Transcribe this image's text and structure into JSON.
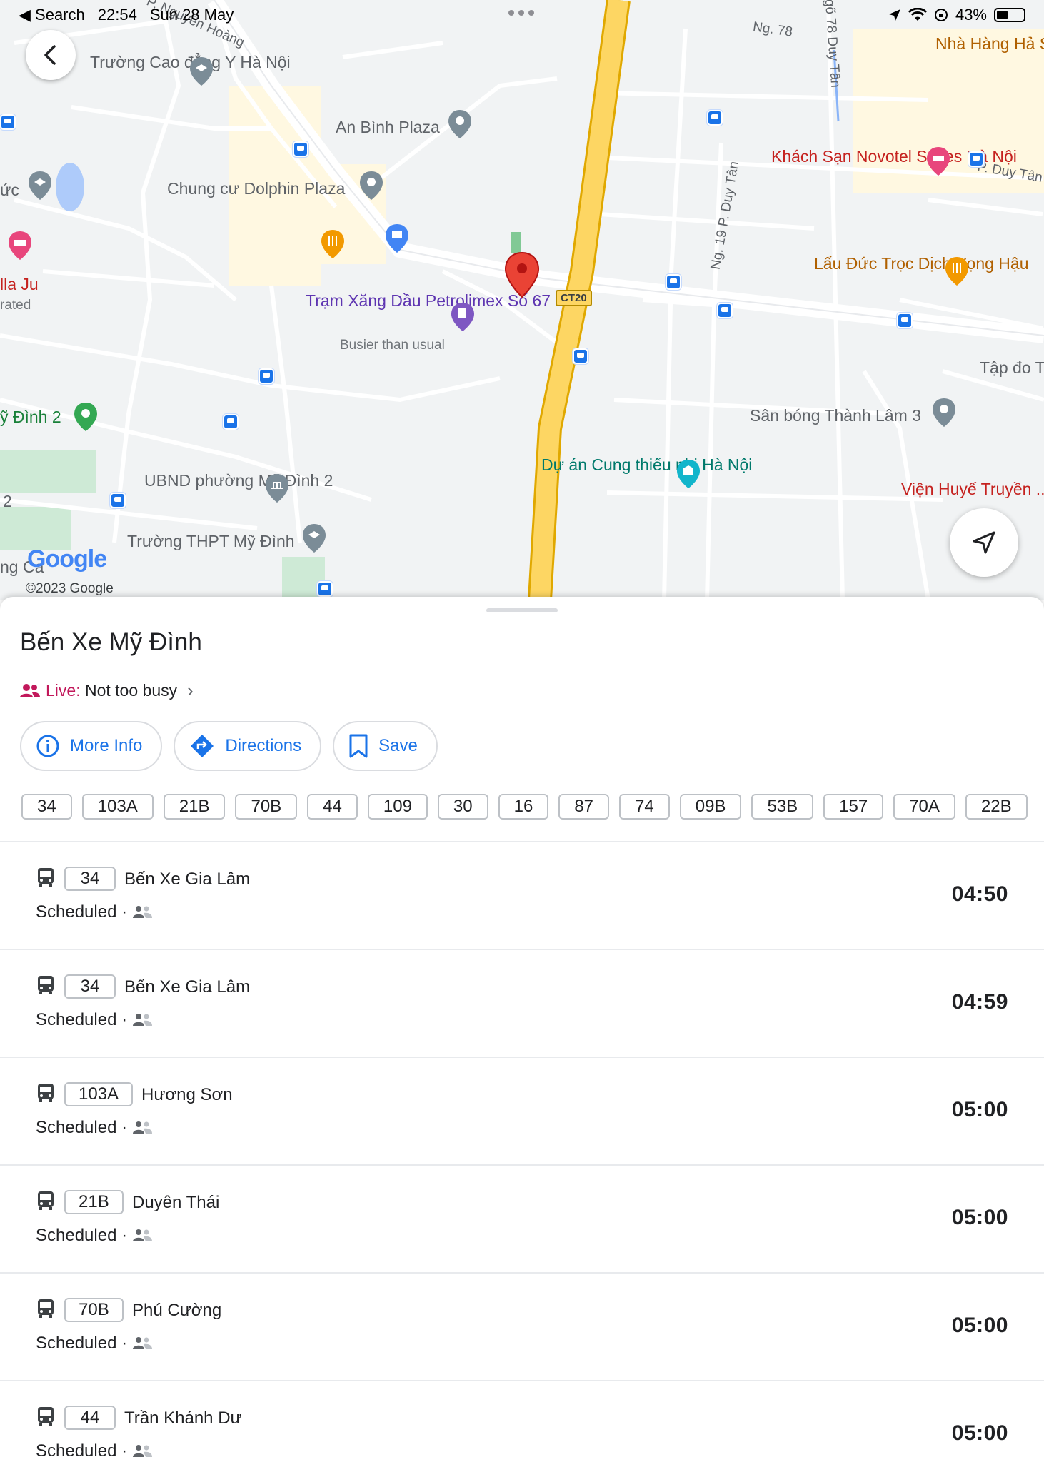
{
  "status_bar": {
    "back_app": "◀ Search",
    "time": "22:54",
    "date": "Sun 28 May",
    "battery": "43%",
    "battery_level": 0.43
  },
  "map": {
    "labels": {
      "truong_cao_dang": "Trường Cao đẳng Y Hà Nội",
      "an_binh_plaza": "An Bình Plaza",
      "chung_cu_dolphin": "Chung cư Dolphin Plaza",
      "tram_xang": "Trạm Xăng Dầu Petrolimex Số 67",
      "busier": "Busier than usual",
      "my_dinh_2": "ỹ Đình 2",
      "ubnd": "UBND phường Mỹ Đình 2",
      "thpt": "Trường THPT Mỹ Đình",
      "khach_san": "Khách Sạn Novotel Suites Hà Nội",
      "lau_duc": "Lẩu Đức Trọc Dịch Vọng Hậu",
      "san_bong": "Sân bóng Thành Lâm 3",
      "du_an": "Dự án Cung thiếu nhi Hà Nội",
      "nha_hang": "Nhà Hàng Hả Sản Biển Đôn",
      "vien_huye": "Viện Huyế Truyền ... Trun",
      "tap_do": "Tập đo Trụ",
      "road_ng78": "Ng. 78",
      "road_duy_tan": "P. Duy Tân",
      "road_ng19": "Ng. 19 P. Duy Tân",
      "road_ngo78": "Ngõ 78 Duy Tân",
      "la_ju": "lla Ju",
      "rated": "rated",
      "uc": "ức",
      "ng_ca": "ng Ca",
      "num2": "2",
      "nguyen_hoang": "P. Nguyễn Hoàng",
      "ct20": "CT20"
    },
    "google_logo": "Google",
    "copyright": "©2023 Google"
  },
  "place": {
    "title": "Bến Xe Mỹ Đình",
    "live_label": "Live",
    "live_status": "Not too busy"
  },
  "actions": {
    "more_info": "More Info",
    "directions": "Directions",
    "save": "Save"
  },
  "routes": [
    "34",
    "103A",
    "21B",
    "70B",
    "44",
    "109",
    "30",
    "16",
    "87",
    "74",
    "09B",
    "53B",
    "157",
    "70A",
    "22B"
  ],
  "departures": [
    {
      "route": "34",
      "headsign": "Bến Xe Gia Lâm",
      "status": "Scheduled ·",
      "time": "04:50"
    },
    {
      "route": "34",
      "headsign": "Bến Xe Gia Lâm",
      "status": "Scheduled ·",
      "time": "04:59"
    },
    {
      "route": "103A",
      "headsign": "Hương Sơn",
      "status": "Scheduled ·",
      "time": "05:00"
    },
    {
      "route": "21B",
      "headsign": "Duyên Thái",
      "status": "Scheduled ·",
      "time": "05:00"
    },
    {
      "route": "70B",
      "headsign": "Phú Cường",
      "status": "Scheduled ·",
      "time": "05:00"
    },
    {
      "route": "44",
      "headsign": "Trần Khánh Dư",
      "status": "Scheduled ·",
      "time": "05:00"
    }
  ],
  "colors": {
    "accent": "#1a73e8",
    "live": "#c2185b",
    "pin": "#ea4335",
    "highway": "#fbc02d"
  }
}
